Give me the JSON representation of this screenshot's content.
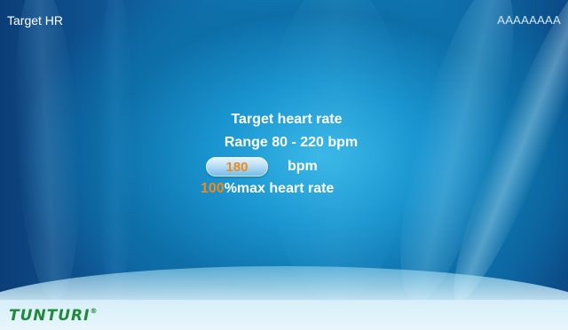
{
  "header": {
    "title": "Target HR",
    "device_id": "AAAAAAAA"
  },
  "content": {
    "heading": "Target heart rate",
    "range": "Range 80 - 220 bpm",
    "bpm_value": "180",
    "bpm_unit": "bpm",
    "percent_value": "100",
    "percent_label": "%max heart rate"
  },
  "footer": {
    "brand": "TUNTURI",
    "trademark": "®"
  },
  "colors": {
    "accent": "#f08a1e",
    "brand": "#1f8a3a",
    "background": "#1487c2"
  }
}
